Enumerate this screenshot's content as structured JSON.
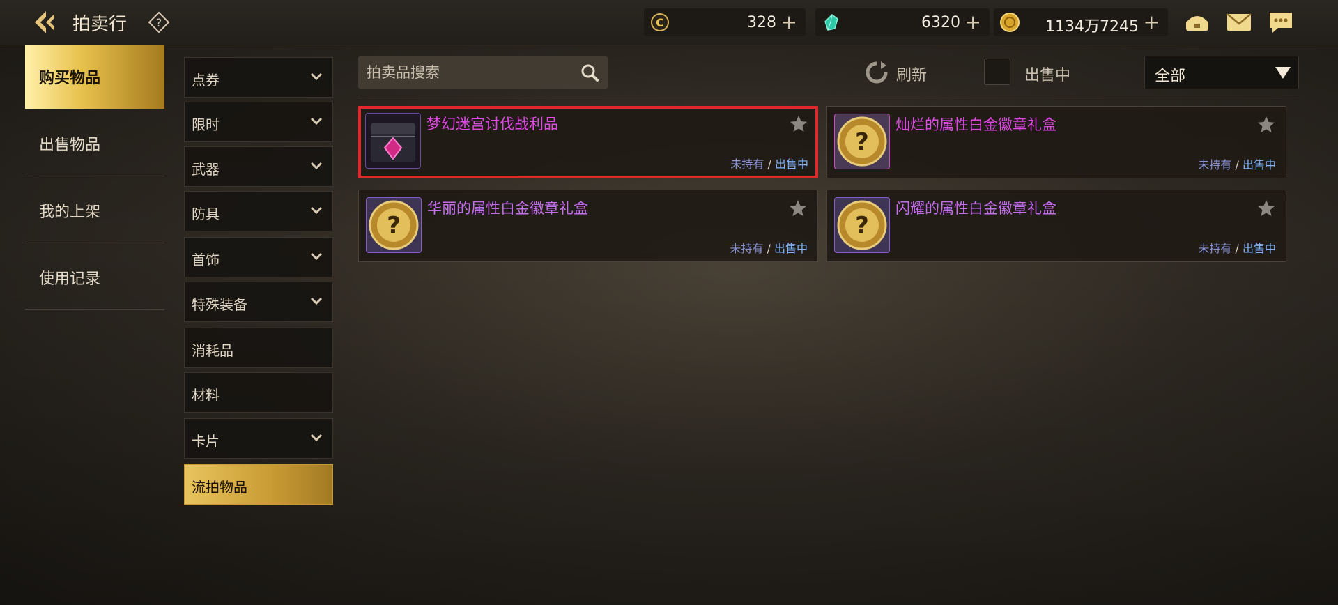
{
  "header": {
    "title": "拍卖行",
    "currencies": [
      {
        "icon": "coupon-icon",
        "value": "328"
      },
      {
        "icon": "crystal-icon",
        "value": "6320"
      },
      {
        "icon": "gold-coin-icon",
        "value": "1134万7245"
      }
    ],
    "plus": "+"
  },
  "main_nav": [
    {
      "label": "购买物品",
      "active": true
    },
    {
      "label": "出售物品",
      "active": false
    },
    {
      "label": "我的上架",
      "active": false
    },
    {
      "label": "使用记录",
      "active": false
    }
  ],
  "categories": [
    {
      "label": "点券"
    },
    {
      "label": "限时"
    },
    {
      "label": "武器"
    },
    {
      "label": "防具"
    },
    {
      "label": "首饰"
    },
    {
      "label": "特殊装备"
    },
    {
      "label": "消耗品"
    },
    {
      "label": "材料"
    },
    {
      "label": "卡片"
    },
    {
      "label": "流拍物品"
    }
  ],
  "toolbar": {
    "search_placeholder": "拍卖品搜索",
    "refresh_label": "刷新",
    "on_sale_label": "出售中",
    "filter_value": "全部"
  },
  "items": [
    {
      "name": "梦幻迷宫讨伐战利品",
      "status_own": "未持有",
      "status_sep": " / ",
      "status_sale": "出售中",
      "selected": true
    },
    {
      "name": "灿烂的属性白金徽章礼盒",
      "status_own": "未持有",
      "status_sep": " / ",
      "status_sale": "出售中",
      "selected": false
    },
    {
      "name": "华丽的属性白金徽章礼盒",
      "status_own": "未持有",
      "status_sep": " / ",
      "status_sale": "出售中",
      "selected": false
    },
    {
      "name": "闪耀的属性白金徽章礼盒",
      "status_own": "未持有",
      "status_sep": " / ",
      "status_sale": "出售中",
      "selected": false
    }
  ],
  "colors": {
    "accent_gold": "#e8c24d",
    "item_name_pink": "#e048e6",
    "item_name_violet": "#c56cf0",
    "selection_red": "#e0282c"
  }
}
